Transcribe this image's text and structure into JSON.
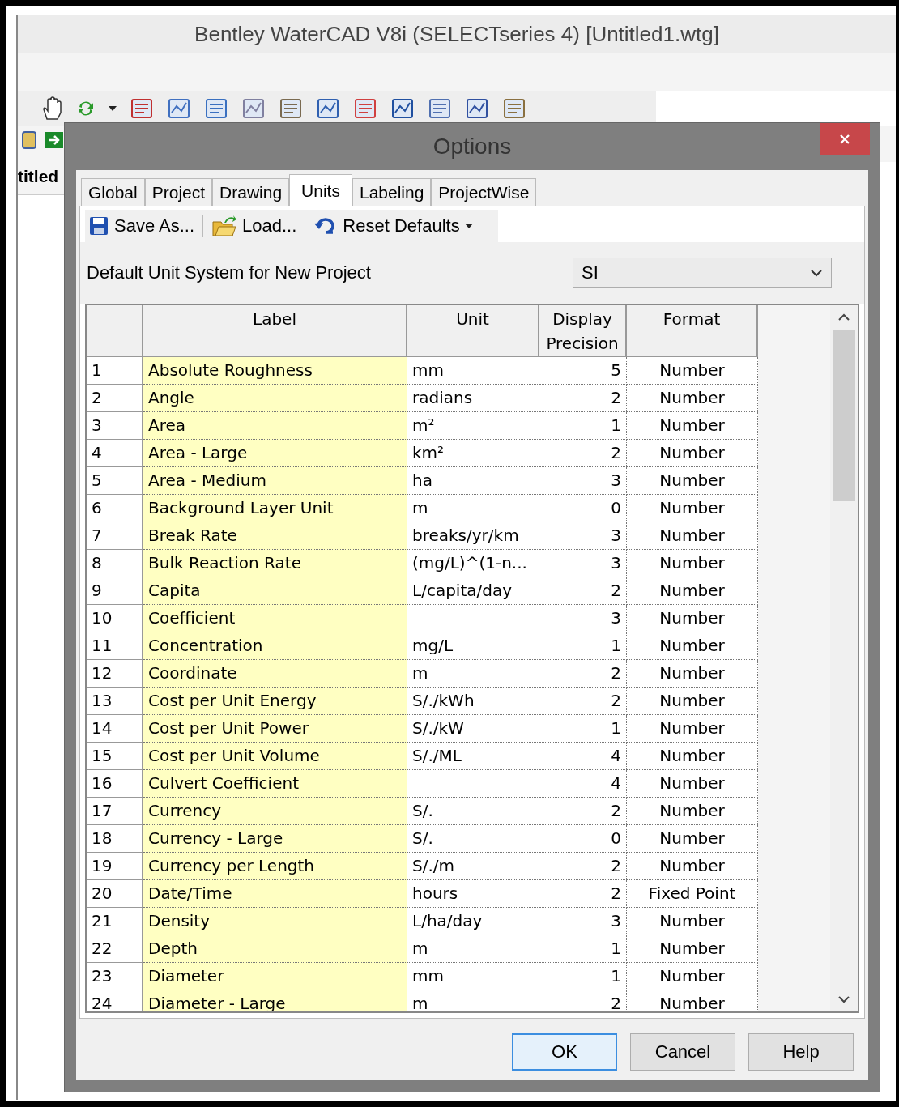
{
  "window": {
    "title": "Bentley WaterCAD V8i (SELECTseries 4) [Untitled1.wtg]",
    "document_tab": "titled"
  },
  "dialog": {
    "title": "Options",
    "tabs": [
      {
        "label": "Global",
        "selected": false
      },
      {
        "label": "Project",
        "selected": false
      },
      {
        "label": "Drawing",
        "selected": false
      },
      {
        "label": "Units",
        "selected": true
      },
      {
        "label": "Labeling",
        "selected": false
      },
      {
        "label": "ProjectWise",
        "selected": false
      }
    ],
    "toolbar": [
      {
        "kind": "save",
        "label": "Save As..."
      },
      {
        "kind": "load",
        "label": "Load..."
      },
      {
        "kind": "reset",
        "label": "Reset Defaults",
        "dropdown": true
      }
    ],
    "unit_system": {
      "label": "Default Unit System for New Project",
      "value": "SI"
    },
    "table": {
      "columns": [
        "Label",
        "Unit",
        "Display Precision",
        "Format"
      ],
      "rows": [
        {
          "number": "1",
          "label": "Absolute Roughness",
          "unit": "mm",
          "precision": "5",
          "format": "Number"
        },
        {
          "number": "2",
          "label": "Angle",
          "unit": "radians",
          "precision": "2",
          "format": "Number"
        },
        {
          "number": "3",
          "label": "Area",
          "unit": "m²",
          "precision": "1",
          "format": "Number"
        },
        {
          "number": "4",
          "label": "Area - Large",
          "unit": "km²",
          "precision": "2",
          "format": "Number"
        },
        {
          "number": "5",
          "label": "Area - Medium",
          "unit": "ha",
          "precision": "3",
          "format": "Number"
        },
        {
          "number": "6",
          "label": "Background Layer Unit",
          "unit": "m",
          "precision": "0",
          "format": "Number"
        },
        {
          "number": "7",
          "label": "Break Rate",
          "unit": "breaks/yr/km",
          "precision": "3",
          "format": "Number"
        },
        {
          "number": "8",
          "label": "Bulk Reaction Rate",
          "unit": "(mg/L)^(1-n...",
          "precision": "3",
          "format": "Number"
        },
        {
          "number": "9",
          "label": "Capita",
          "unit": "L/capita/day",
          "precision": "2",
          "format": "Number"
        },
        {
          "number": "10",
          "label": "Coefficient",
          "precision": "3",
          "format": "Number"
        },
        {
          "number": "11",
          "label": "Concentration",
          "unit": "mg/L",
          "precision": "1",
          "format": "Number"
        },
        {
          "number": "12",
          "label": "Coordinate",
          "unit": "m",
          "precision": "2",
          "format": "Number"
        },
        {
          "number": "13",
          "label": "Cost per Unit Energy",
          "unit": "S/./kWh",
          "precision": "2",
          "format": "Number"
        },
        {
          "number": "14",
          "label": "Cost per Unit Power",
          "unit": "S/./kW",
          "precision": "1",
          "format": "Number"
        },
        {
          "number": "15",
          "label": "Cost per Unit Volume",
          "unit": "S/./ML",
          "precision": "4",
          "format": "Number"
        },
        {
          "number": "16",
          "label": "Culvert Coefficient",
          "precision": "4",
          "format": "Number"
        },
        {
          "number": "17",
          "label": "Currency",
          "unit": "S/.",
          "precision": "2",
          "format": "Number"
        },
        {
          "number": "18",
          "label": "Currency - Large",
          "unit": "S/.",
          "precision": "0",
          "format": "Number"
        },
        {
          "number": "19",
          "label": "Currency per Length",
          "unit": "S/./m",
          "precision": "2",
          "format": "Number"
        },
        {
          "number": "20",
          "label": "Date/Time",
          "unit": "hours",
          "precision": "2",
          "format": "Fixed Point"
        },
        {
          "number": "21",
          "label": "Density",
          "unit": "L/ha/day",
          "precision": "3",
          "format": "Number"
        },
        {
          "number": "22",
          "label": "Depth",
          "unit": "m",
          "precision": "1",
          "format": "Number"
        },
        {
          "number": "23",
          "label": "Diameter",
          "unit": "mm",
          "precision": "1",
          "format": "Number"
        },
        {
          "number": "24",
          "label": "Diameter - Large",
          "unit": "m",
          "precision": "2",
          "format": "Number"
        }
      ]
    },
    "buttons": [
      {
        "label": "OK",
        "focused": true
      },
      {
        "label": "Cancel",
        "focused": false
      },
      {
        "label": "Help",
        "focused": false
      }
    ]
  }
}
